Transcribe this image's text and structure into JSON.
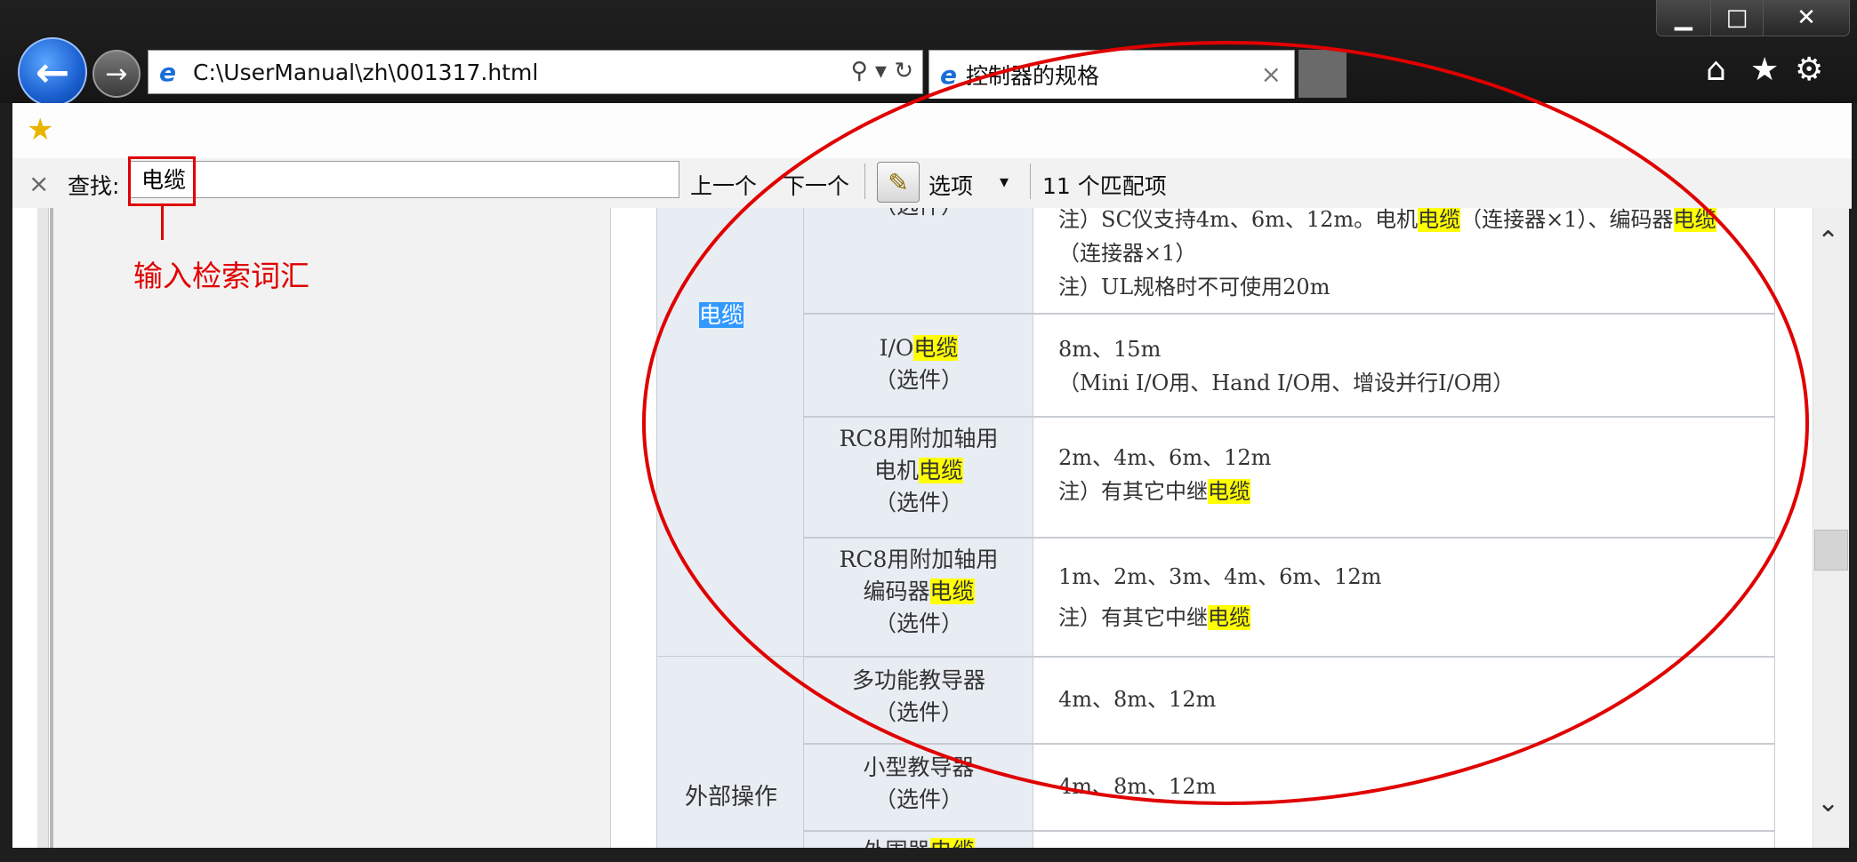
{
  "browser": {
    "address_url": "C:\\UserManual\\zh\\001317.html",
    "tab_title": "控制器的规格",
    "favicon_glyph": "e",
    "back_glyph": "←",
    "forward_glyph": "→",
    "tab_close_glyph": "×",
    "address_tools_glyphs": "⚲ ▾ ↻",
    "window_controls": {
      "minimize": "▁",
      "maximize": "□",
      "close": "✕"
    },
    "top_icons": {
      "home": "⌂",
      "favorites": "★",
      "settings": "⚙"
    }
  },
  "find_bar": {
    "close_glyph": "×",
    "label": "查找:",
    "query": "电缆",
    "prev_label": "上一个",
    "next_label": "下一个",
    "options_label": "选项",
    "options_arrow": "▾",
    "match_count": "11 个匹配项"
  },
  "annotation": {
    "text": "输入检索词汇",
    "color": "#e00000"
  },
  "table": {
    "category_cable": "电缆",
    "category_external": "外部操作",
    "row0_label_part": "（选件）",
    "row0_line1_a": "注）SC仪支持4m、6m、12m。电机",
    "row0_line1_hl1": "电缆",
    "row0_line1_b": "（连接器×1）、编码器",
    "row0_line1_hl2": "电缆",
    "row0_line2": "（连接器×1）",
    "row0_line3": "注）UL规格时不可使用20m",
    "row1_label_a": "I/O",
    "row1_label_hl": "电缆",
    "row1_label_b": "（选件）",
    "row1_val_1": "8m、15m",
    "row1_val_2": "（Mini I/O用、Hand I/O用、增设并行I/O用）",
    "row2_label_1": "RC8用附加轴用",
    "row2_label_2a": "电机",
    "row2_label_hl": "电缆",
    "row2_label_3": "（选件）",
    "row2_val_1": "2m、4m、6m、12m",
    "row2_val_2a": "注）有其它中继",
    "row2_val_hl": "电缆",
    "row3_label_1": "RC8用附加轴用",
    "row3_label_2a": "编码器",
    "row3_label_hl": "电缆",
    "row3_label_3": "（选件）",
    "row3_val_1": "1m、2m、3m、4m、6m、12m",
    "row3_val_2a": "注）有其它中继",
    "row3_val_hl": "电缆",
    "row4_label_1": "多功能教导器",
    "row4_label_2": "（选件）",
    "row4_val": "4m、8m、12m",
    "row5_label_1": "小型教导器",
    "row5_label_2": "（选件）",
    "row5_val": "4m、8m、12m",
    "row6_label_partial_a": "外围器",
    "row6_label_partial_hl": "电缆"
  },
  "colors": {
    "highlight": "#ffff00",
    "selected_highlight": "#3399ff",
    "annotation_red": "#e00000",
    "ellipse_red": "#e00000"
  },
  "icons": [
    "back-arrow-icon",
    "forward-arrow-icon",
    "ie-logo-icon",
    "search-icon",
    "refresh-icon",
    "close-icon",
    "home-icon",
    "star-icon",
    "gear-icon",
    "favorites-add-icon",
    "highlight-pen-icon",
    "chevron-up-icon",
    "chevron-down-icon"
  ]
}
